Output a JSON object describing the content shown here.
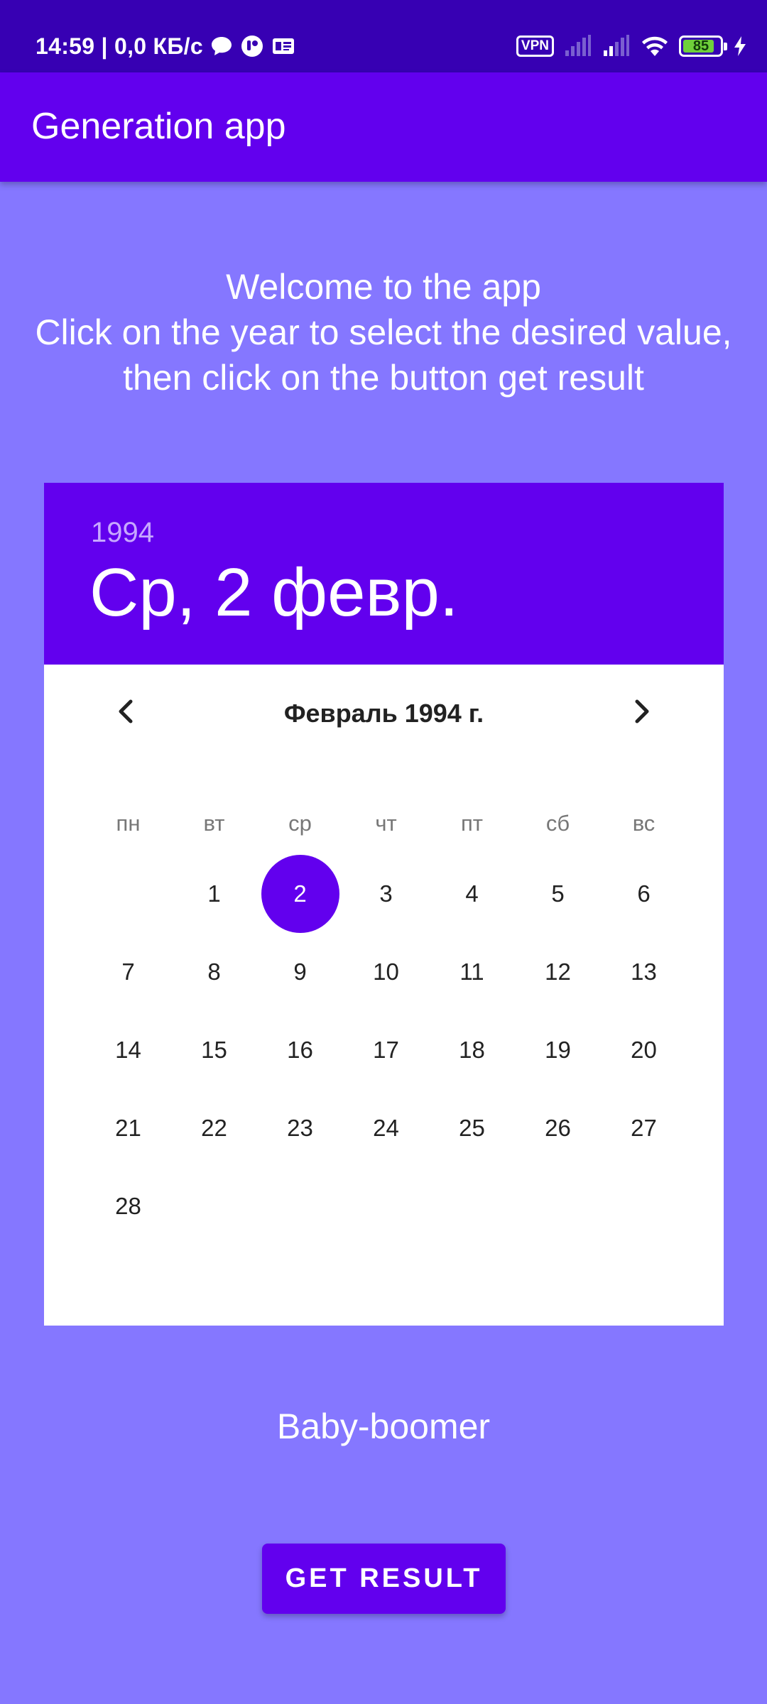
{
  "status_bar": {
    "time_info": "14:59 | 0,0 КБ/с",
    "left_icons": [
      "chat-bubble-icon",
      "app-notification-icon",
      "card-icon"
    ],
    "vpn_label": "VPN",
    "battery_level": "85",
    "battery_fraction": 0.85
  },
  "app_bar": {
    "title": "Generation app"
  },
  "welcome": {
    "line1": "Welcome to the app",
    "line2": "Click on the year to select the desired value,",
    "line3": "then click on the button get result"
  },
  "calendar": {
    "year": "1994",
    "selected_date": "Ср, 2 февр.",
    "month_label": "Февраль 1994 г.",
    "weekdays": [
      "пн",
      "вт",
      "ср",
      "чт",
      "пт",
      "сб",
      "вс"
    ],
    "leading_empty_days": 1,
    "days": [
      "1",
      "2",
      "3",
      "4",
      "5",
      "6",
      "7",
      "8",
      "9",
      "10",
      "11",
      "12",
      "13",
      "14",
      "15",
      "16",
      "17",
      "18",
      "19",
      "20",
      "21",
      "22",
      "23",
      "24",
      "25",
      "26",
      "27",
      "28"
    ],
    "selected_day": "2",
    "accent_color": "#6200ee"
  },
  "result": {
    "text": "Baby-boomer"
  },
  "button": {
    "label": "GET RESULT"
  },
  "colors": {
    "status_bar": "#3700b3",
    "primary": "#6200ee",
    "background": "#8577ff"
  }
}
